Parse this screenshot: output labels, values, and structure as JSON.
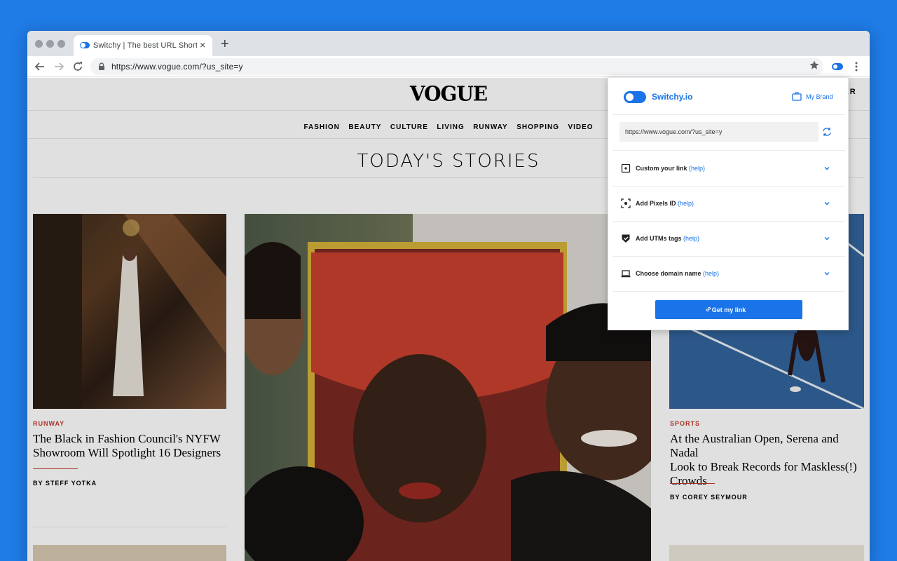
{
  "browser": {
    "tab_title": "Switchy | The best URL Shortener",
    "tab_close": "×",
    "new_tab": "+",
    "url": "https://www.vogue.com/?us_site=y"
  },
  "page": {
    "logo": "VOGUE",
    "top_right_text": "TTER",
    "nav_items": [
      "FASHION",
      "BEAUTY",
      "CULTURE",
      "LIVING",
      "RUNWAY",
      "SHOPPING",
      "VIDEO"
    ],
    "section_title": "TODAY'S STORIES",
    "cards": [
      {
        "rubric": "RUNWAY",
        "headline_line1": "The Black in Fashion Council's NYFW",
        "headline_line2": "Showroom Will Spotlight 16 Designers",
        "byline": "BY STEFF YOTKA"
      },
      {
        "rubric": "SPORTS",
        "headline_line1": "At the Australian Open, Serena and Nadal",
        "headline_line2": "Look to Break Records for Maskless(!)",
        "headline_line3": "Crowds",
        "byline": "BY COREY SEYMOUR"
      }
    ]
  },
  "popup": {
    "brand": "Switchy.io",
    "my_brand": "My Brand",
    "url_value": "https://www.vogue.com/?us_site=y",
    "rows": [
      {
        "label": "Custom your link",
        "help": "(help)",
        "icon": "custom-link-icon"
      },
      {
        "label": "Add Pixels ID",
        "help": "(help)",
        "icon": "pixel-icon"
      },
      {
        "label": "Add UTMs tags",
        "help": "(help)",
        "icon": "shield-check-icon"
      },
      {
        "label": "Choose domain name",
        "help": "(help)",
        "icon": "laptop-icon"
      }
    ],
    "button": "Get my link"
  },
  "colors": {
    "accent": "#1a73e8",
    "background": "#1f7be6",
    "rubric": "#c23a2b"
  }
}
